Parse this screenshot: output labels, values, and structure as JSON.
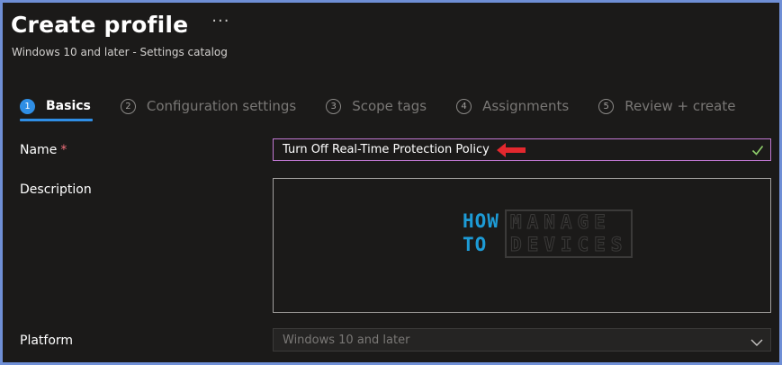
{
  "header": {
    "title": "Create profile",
    "more_icon": "···",
    "subtitle": "Windows 10 and later - Settings catalog"
  },
  "steps": [
    {
      "number": "1",
      "label": "Basics",
      "active": true
    },
    {
      "number": "2",
      "label": "Configuration settings",
      "active": false
    },
    {
      "number": "3",
      "label": "Scope tags",
      "active": false
    },
    {
      "number": "4",
      "label": "Assignments",
      "active": false
    },
    {
      "number": "5",
      "label": "Review + create",
      "active": false
    }
  ],
  "form": {
    "name_label": "Name",
    "required_marker": "*",
    "name_value": "Turn Off Real-Time Protection Policy",
    "description_label": "Description",
    "description_value": "",
    "platform_label": "Platform",
    "platform_value": "Windows 10 and later"
  },
  "watermark": {
    "line1_left": "HOW",
    "line2_left": "TO",
    "line1_right": "MANAGE",
    "line2_right": "DEVICES"
  },
  "colors": {
    "accent": "#2f8ee5",
    "name_border": "#c178d2",
    "arrow": "#e3282e",
    "check": "#8fcf6b",
    "required": "#f1707b"
  },
  "icons": {
    "more": "more-horizontal-icon",
    "arrow": "red-arrow-left-icon",
    "check": "checkmark-icon",
    "chevron": "chevron-down-icon"
  }
}
